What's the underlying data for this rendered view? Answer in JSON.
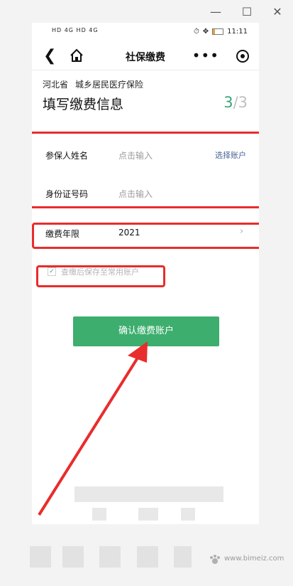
{
  "window": {
    "minimize_icon": "minimize-icon",
    "maximize_icon": "maximize-icon",
    "close_icon": "close-icon"
  },
  "status_bar": {
    "left_text": "HD 4G HD 4G",
    "time": "11:11",
    "battery_color": "#e8a33b",
    "battery_level": 0.2
  },
  "nav": {
    "title": "社保缴费",
    "back_icon": "back-arrow-icon",
    "home_icon": "home-icon",
    "more_icon": "more-dots-icon",
    "target_icon": "target-icon"
  },
  "header": {
    "province": "河北省",
    "insurance_type": "城乡居民医疗保险",
    "title": "填写缴费信息",
    "step_current": "3",
    "step_separator_total": "/3"
  },
  "form": {
    "name_label": "参保人姓名",
    "name_placeholder": "点击输入",
    "select_account": "选择账户",
    "id_label": "身份证号码",
    "id_placeholder": "点击输入",
    "year_label": "缴费年限",
    "year_value": "2021",
    "save_account_text": "查缴后保存至常用账户"
  },
  "confirm_button": "确认缴费账户",
  "watermark_text": "www.bimeiz.com",
  "colors": {
    "accent_green": "#3dae6e",
    "step_green": "#3aa679",
    "annotation_red": "#e92c2c",
    "link_blue": "#496596"
  }
}
